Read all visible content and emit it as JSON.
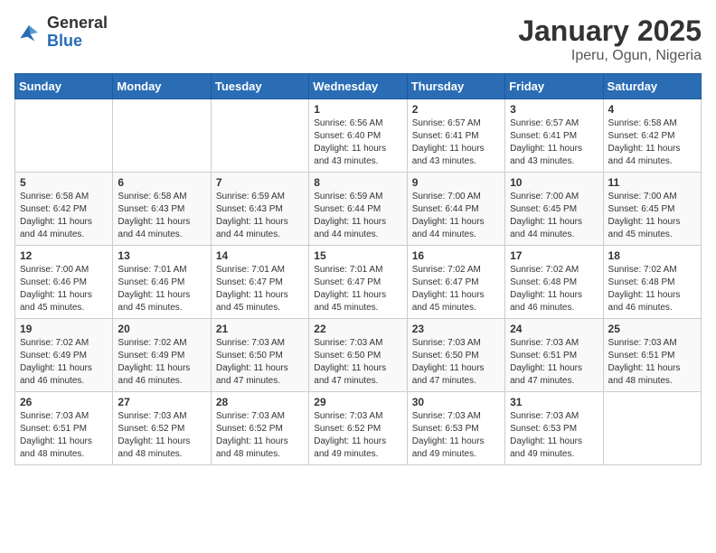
{
  "header": {
    "logo_general": "General",
    "logo_blue": "Blue",
    "title": "January 2025",
    "subtitle": "Iperu, Ogun, Nigeria"
  },
  "calendar": {
    "days_of_week": [
      "Sunday",
      "Monday",
      "Tuesday",
      "Wednesday",
      "Thursday",
      "Friday",
      "Saturday"
    ],
    "weeks": [
      [
        {
          "day": "",
          "info": ""
        },
        {
          "day": "",
          "info": ""
        },
        {
          "day": "",
          "info": ""
        },
        {
          "day": "1",
          "info": "Sunrise: 6:56 AM\nSunset: 6:40 PM\nDaylight: 11 hours\nand 43 minutes."
        },
        {
          "day": "2",
          "info": "Sunrise: 6:57 AM\nSunset: 6:41 PM\nDaylight: 11 hours\nand 43 minutes."
        },
        {
          "day": "3",
          "info": "Sunrise: 6:57 AM\nSunset: 6:41 PM\nDaylight: 11 hours\nand 43 minutes."
        },
        {
          "day": "4",
          "info": "Sunrise: 6:58 AM\nSunset: 6:42 PM\nDaylight: 11 hours\nand 44 minutes."
        }
      ],
      [
        {
          "day": "5",
          "info": "Sunrise: 6:58 AM\nSunset: 6:42 PM\nDaylight: 11 hours\nand 44 minutes."
        },
        {
          "day": "6",
          "info": "Sunrise: 6:58 AM\nSunset: 6:43 PM\nDaylight: 11 hours\nand 44 minutes."
        },
        {
          "day": "7",
          "info": "Sunrise: 6:59 AM\nSunset: 6:43 PM\nDaylight: 11 hours\nand 44 minutes."
        },
        {
          "day": "8",
          "info": "Sunrise: 6:59 AM\nSunset: 6:44 PM\nDaylight: 11 hours\nand 44 minutes."
        },
        {
          "day": "9",
          "info": "Sunrise: 7:00 AM\nSunset: 6:44 PM\nDaylight: 11 hours\nand 44 minutes."
        },
        {
          "day": "10",
          "info": "Sunrise: 7:00 AM\nSunset: 6:45 PM\nDaylight: 11 hours\nand 44 minutes."
        },
        {
          "day": "11",
          "info": "Sunrise: 7:00 AM\nSunset: 6:45 PM\nDaylight: 11 hours\nand 45 minutes."
        }
      ],
      [
        {
          "day": "12",
          "info": "Sunrise: 7:00 AM\nSunset: 6:46 PM\nDaylight: 11 hours\nand 45 minutes."
        },
        {
          "day": "13",
          "info": "Sunrise: 7:01 AM\nSunset: 6:46 PM\nDaylight: 11 hours\nand 45 minutes."
        },
        {
          "day": "14",
          "info": "Sunrise: 7:01 AM\nSunset: 6:47 PM\nDaylight: 11 hours\nand 45 minutes."
        },
        {
          "day": "15",
          "info": "Sunrise: 7:01 AM\nSunset: 6:47 PM\nDaylight: 11 hours\nand 45 minutes."
        },
        {
          "day": "16",
          "info": "Sunrise: 7:02 AM\nSunset: 6:47 PM\nDaylight: 11 hours\nand 45 minutes."
        },
        {
          "day": "17",
          "info": "Sunrise: 7:02 AM\nSunset: 6:48 PM\nDaylight: 11 hours\nand 46 minutes."
        },
        {
          "day": "18",
          "info": "Sunrise: 7:02 AM\nSunset: 6:48 PM\nDaylight: 11 hours\nand 46 minutes."
        }
      ],
      [
        {
          "day": "19",
          "info": "Sunrise: 7:02 AM\nSunset: 6:49 PM\nDaylight: 11 hours\nand 46 minutes."
        },
        {
          "day": "20",
          "info": "Sunrise: 7:02 AM\nSunset: 6:49 PM\nDaylight: 11 hours\nand 46 minutes."
        },
        {
          "day": "21",
          "info": "Sunrise: 7:03 AM\nSunset: 6:50 PM\nDaylight: 11 hours\nand 47 minutes."
        },
        {
          "day": "22",
          "info": "Sunrise: 7:03 AM\nSunset: 6:50 PM\nDaylight: 11 hours\nand 47 minutes."
        },
        {
          "day": "23",
          "info": "Sunrise: 7:03 AM\nSunset: 6:50 PM\nDaylight: 11 hours\nand 47 minutes."
        },
        {
          "day": "24",
          "info": "Sunrise: 7:03 AM\nSunset: 6:51 PM\nDaylight: 11 hours\nand 47 minutes."
        },
        {
          "day": "25",
          "info": "Sunrise: 7:03 AM\nSunset: 6:51 PM\nDaylight: 11 hours\nand 48 minutes."
        }
      ],
      [
        {
          "day": "26",
          "info": "Sunrise: 7:03 AM\nSunset: 6:51 PM\nDaylight: 11 hours\nand 48 minutes."
        },
        {
          "day": "27",
          "info": "Sunrise: 7:03 AM\nSunset: 6:52 PM\nDaylight: 11 hours\nand 48 minutes."
        },
        {
          "day": "28",
          "info": "Sunrise: 7:03 AM\nSunset: 6:52 PM\nDaylight: 11 hours\nand 48 minutes."
        },
        {
          "day": "29",
          "info": "Sunrise: 7:03 AM\nSunset: 6:52 PM\nDaylight: 11 hours\nand 49 minutes."
        },
        {
          "day": "30",
          "info": "Sunrise: 7:03 AM\nSunset: 6:53 PM\nDaylight: 11 hours\nand 49 minutes."
        },
        {
          "day": "31",
          "info": "Sunrise: 7:03 AM\nSunset: 6:53 PM\nDaylight: 11 hours\nand 49 minutes."
        },
        {
          "day": "",
          "info": ""
        }
      ]
    ]
  }
}
